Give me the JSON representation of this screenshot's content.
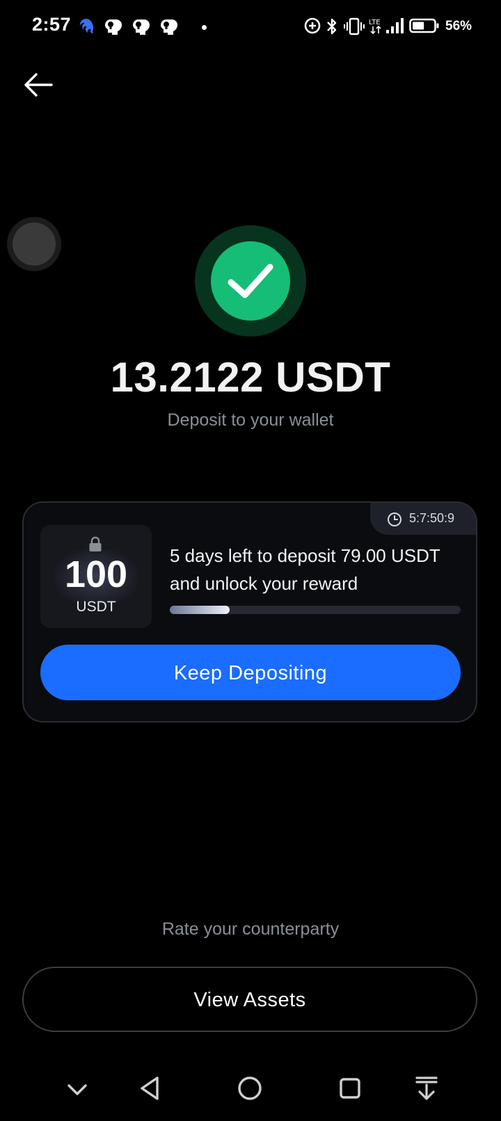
{
  "status_bar": {
    "time": "2:57",
    "battery_percent": "56%",
    "battery_level": 0.56,
    "icons": [
      "app-swirl-icon",
      "bulb-head-icon",
      "bulb-head-icon",
      "bulb-head-icon",
      "dot-icon",
      "data-saver-icon",
      "bluetooth-icon",
      "vibrate-icon",
      "lte-icon",
      "signal-icon",
      "battery-icon"
    ]
  },
  "header": {
    "back_icon": "arrow-left-icon"
  },
  "success": {
    "icon": "check-icon",
    "amount": "13.2122 USDT",
    "subtitle": "Deposit to your wallet"
  },
  "reward_card": {
    "timer": "5:7:50:9",
    "timer_icon": "clock-icon",
    "lock_icon": "lock-icon",
    "reward_amount": "100",
    "reward_unit": "USDT",
    "message": "5 days left to deposit 79.00 USDT and unlock your reward",
    "progress": 0.205,
    "button_label": "Keep Depositing"
  },
  "footer": {
    "rate_label": "Rate your counterparty",
    "view_assets_label": "View Assets"
  },
  "nav_bar": {
    "icons": [
      "chevron-down-icon",
      "back-triangle-icon",
      "home-circle-icon",
      "recents-square-icon",
      "pull-down-icon"
    ]
  },
  "colors": {
    "background": "#000000",
    "success_green": "#16bd76",
    "accent_blue": "#1a6dff",
    "muted_text": "#8a8f98"
  }
}
